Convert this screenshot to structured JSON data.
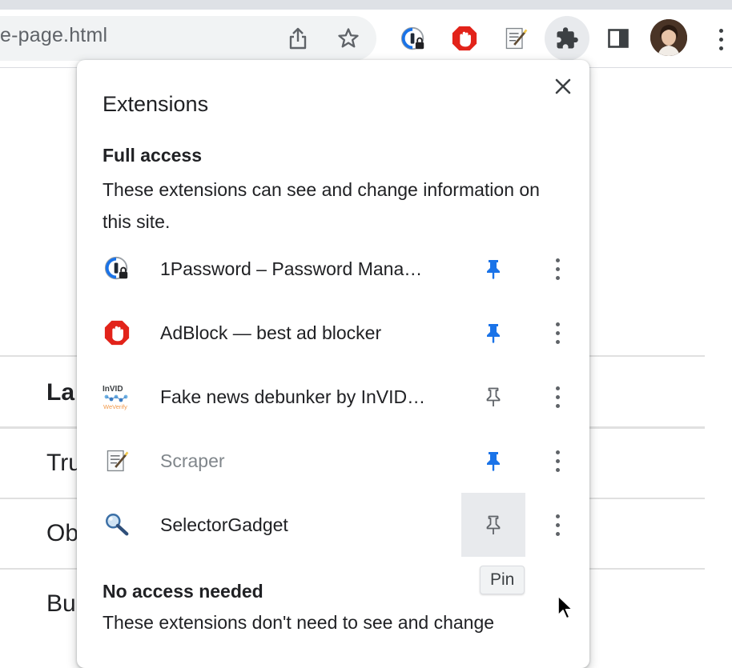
{
  "browser": {
    "url_fragment": "e-page.html",
    "icons": {
      "share": "share-icon",
      "bookmark": "star-icon",
      "onepassword": "1password-icon",
      "adblock": "adblock-icon",
      "scraper": "scraper-icon",
      "extensions": "puzzle-icon",
      "side_panel": "side-panel-icon",
      "profile": "avatar",
      "menu": "kebab-menu-icon"
    }
  },
  "background_page": {
    "rows": [
      "La",
      "Tru",
      "Ob",
      "Bu"
    ]
  },
  "popup": {
    "title": "Extensions",
    "close_icon": "close-icon",
    "full_access": {
      "heading": "Full access",
      "description": "These extensions can see and change information on this site."
    },
    "extensions": [
      {
        "name": "1Password – Password Mana…",
        "pinned": true,
        "dimmed": false
      },
      {
        "name": "AdBlock — best ad blocker",
        "pinned": true,
        "dimmed": false
      },
      {
        "name": "Fake news debunker by InVID…",
        "pinned": false,
        "dimmed": false
      },
      {
        "name": "Scraper",
        "pinned": true,
        "dimmed": true
      },
      {
        "name": "SelectorGadget",
        "pinned": false,
        "dimmed": false
      }
    ],
    "invid_logo": {
      "line1": "InVID",
      "line2": "WeVerify"
    },
    "tooltip": "Pin",
    "no_access": {
      "heading": "No access needed",
      "partial_text": "These extensions don't need to see and change"
    }
  },
  "colors": {
    "pin_active": "#1a73e8",
    "pin_inactive": "#5f6368",
    "adblock_red": "#e2231a"
  }
}
